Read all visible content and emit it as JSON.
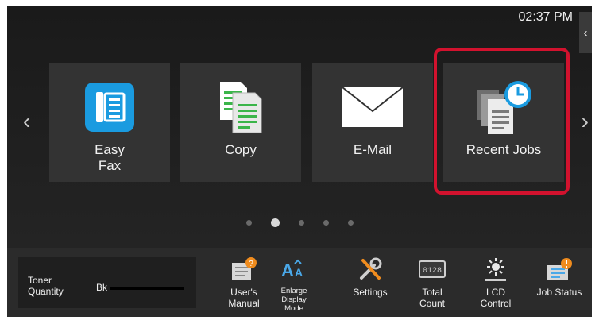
{
  "clock": "02:37 PM",
  "nav": {
    "prev": "‹",
    "next": "›",
    "side_tab": "‹"
  },
  "tiles": [
    {
      "label": "Easy\nFax",
      "icon": "fax-icon"
    },
    {
      "label": "Copy",
      "icon": "copy-icon"
    },
    {
      "label": "E-Mail",
      "icon": "email-icon"
    },
    {
      "label": "Recent Jobs",
      "icon": "recent-jobs-icon"
    }
  ],
  "highlight_color": "#d2122e",
  "page_dots": {
    "count": 5,
    "active": 2
  },
  "toner": {
    "label": "Toner\nQuantity",
    "color_label": "Bk"
  },
  "bottom_buttons": [
    {
      "label": "User's\nManual",
      "icon": "users-manual-icon"
    },
    {
      "label": "Enlarge\nDisplay\nMode",
      "icon": "enlarge-display-icon"
    },
    {
      "label": "Settings",
      "icon": "settings-icon"
    },
    {
      "label": "Total\nCount",
      "icon": "total-count-icon"
    },
    {
      "label": "LCD\nControl",
      "icon": "lcd-control-icon"
    },
    {
      "label": "Job Status",
      "icon": "job-status-icon"
    }
  ],
  "total_count_display": "0128"
}
